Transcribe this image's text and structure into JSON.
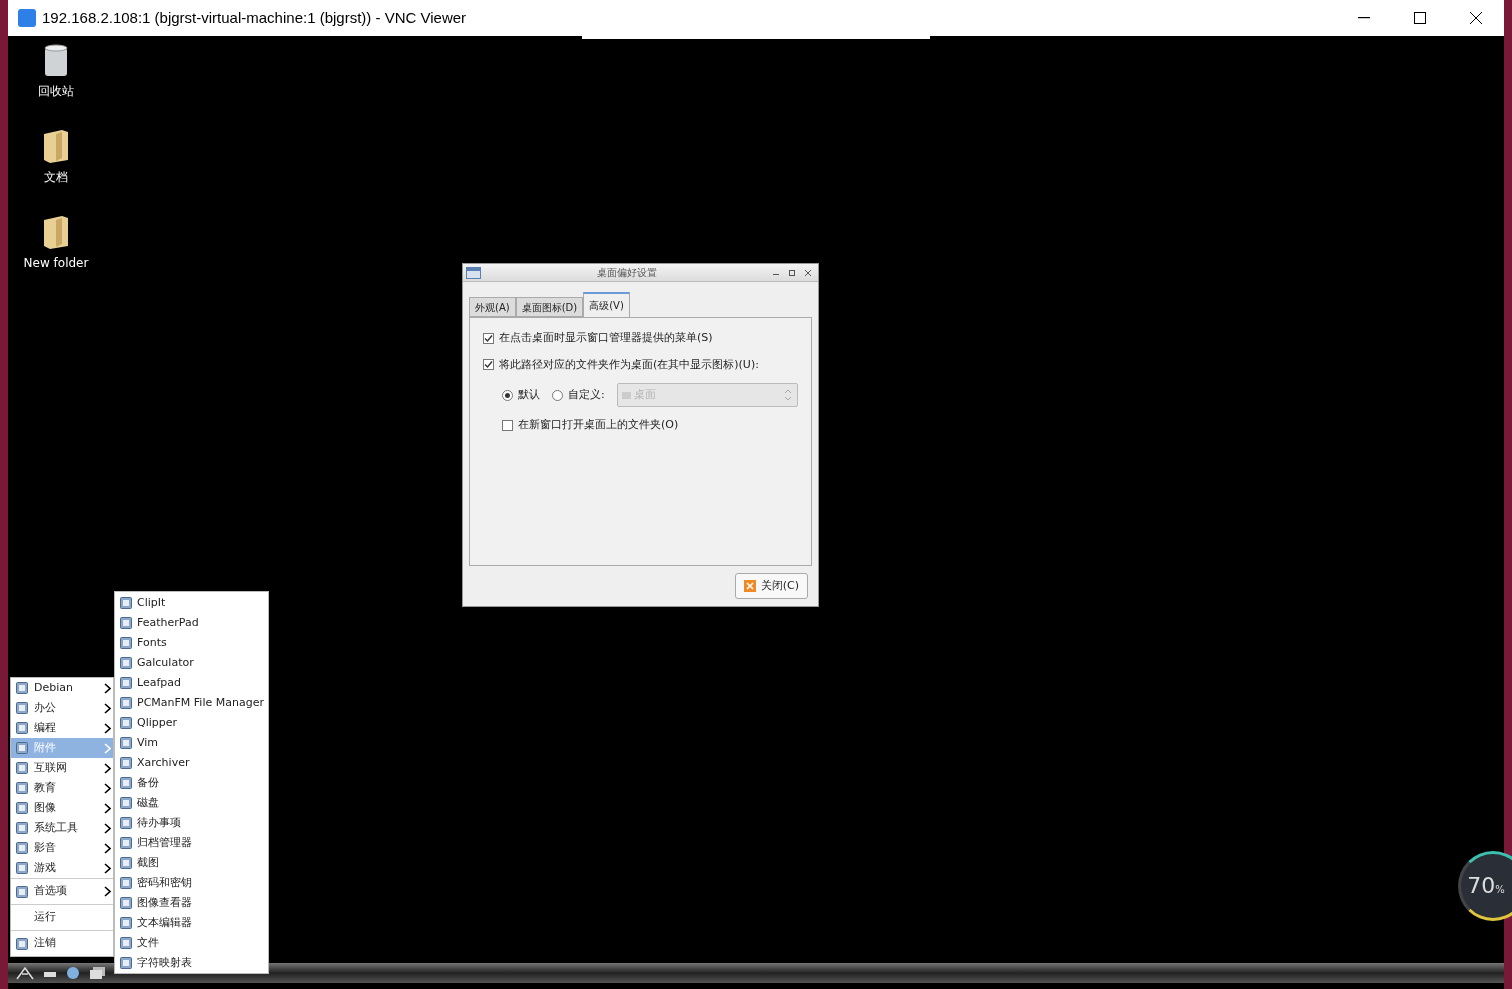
{
  "window": {
    "title": "192.168.2.108:1 (bjgrst-virtual-machine:1 (bjgrst)) - VNC Viewer"
  },
  "desktop_icons": [
    {
      "label": "回收站",
      "kind": "trash"
    },
    {
      "label": "文档",
      "kind": "folder"
    },
    {
      "label": "New folder",
      "kind": "folder"
    }
  ],
  "dialog": {
    "title": "桌面偏好设置",
    "tabs": [
      {
        "label": "外观(A)",
        "selected": false
      },
      {
        "label": "桌面图标(D)",
        "selected": false
      },
      {
        "label": "高级(V)",
        "selected": true
      }
    ],
    "options": [
      {
        "label": "在点击桌面时显示窗口管理器提供的菜单(S)",
        "checked": true
      },
      {
        "label": "将此路径对应的文件夹作为桌面(在其中显示图标)(U):",
        "checked": true
      }
    ],
    "radios": [
      {
        "label": "默认",
        "selected": true
      },
      {
        "label": "自定义:",
        "selected": false
      }
    ],
    "path_field": {
      "value": "桌面",
      "disabled": true
    },
    "sub_option": {
      "label": "在新窗口打开桌面上的文件夹(O)",
      "checked": false
    },
    "close_button": "关闭(C)"
  },
  "menu": {
    "sections": [
      [
        {
          "label": "Debian",
          "submenu": true,
          "selected": false
        },
        {
          "label": "办公",
          "submenu": true,
          "selected": false
        },
        {
          "label": "编程",
          "submenu": true,
          "selected": false
        },
        {
          "label": "附件",
          "submenu": true,
          "selected": true
        },
        {
          "label": "互联网",
          "submenu": true,
          "selected": false
        },
        {
          "label": "教育",
          "submenu": true,
          "selected": false
        },
        {
          "label": "图像",
          "submenu": true,
          "selected": false
        },
        {
          "label": "系统工具",
          "submenu": true,
          "selected": false
        },
        {
          "label": "影音",
          "submenu": true,
          "selected": false
        },
        {
          "label": "游戏",
          "submenu": true,
          "selected": false
        }
      ],
      [
        {
          "label": "首选项",
          "submenu": true,
          "selected": false
        }
      ],
      [
        {
          "label": "运行",
          "submenu": false,
          "selected": false
        }
      ],
      [
        {
          "label": "注销",
          "submenu": false,
          "selected": false
        }
      ]
    ],
    "submenu": [
      "ClipIt",
      "FeatherPad",
      "Fonts",
      "Galculator",
      "Leafpad",
      "PCManFM File Manager",
      "Qlipper",
      "Vim",
      "Xarchiver",
      "备份",
      "磁盘",
      "待办事项",
      "归档管理器",
      "截图",
      "密码和密钥",
      "图像查看器",
      "文本编辑器",
      "文件",
      "字符映射表"
    ]
  },
  "speed_ball": {
    "value": "70",
    "unit": "%"
  }
}
